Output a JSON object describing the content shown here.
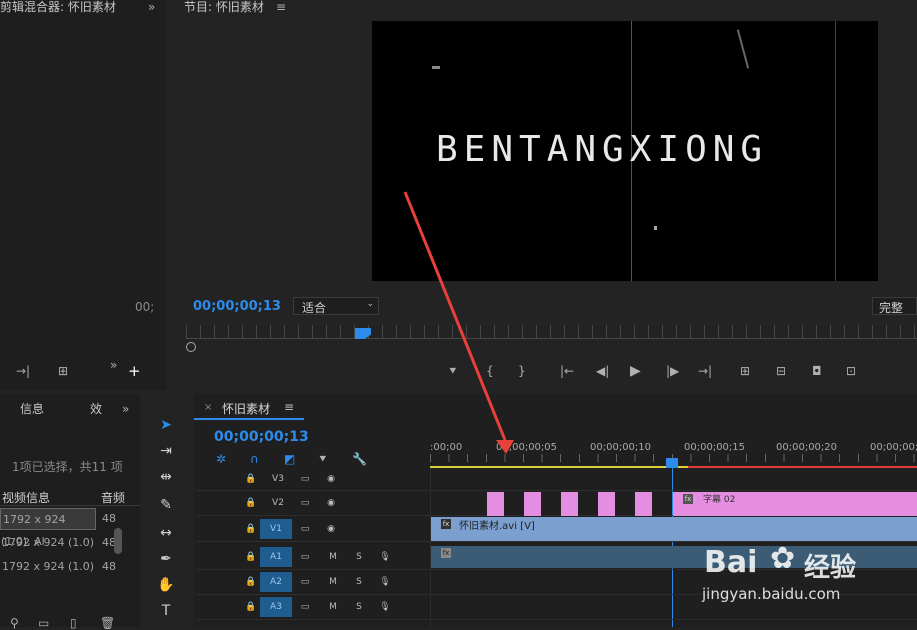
{
  "mixer": {
    "title": "剪辑混合器: 怀旧素材",
    "timecode": "00;"
  },
  "program": {
    "title": "节目: 怀旧素材",
    "video_text": "BENTANGXIONG",
    "timecode": "00;00;00;13",
    "fit": "适合",
    "quality": "完整"
  },
  "info": {
    "tab_info": "信息",
    "tab_effects": "效",
    "selection": "1项已选择，共11 项",
    "col_video": "视频信息",
    "col_audio": "音频",
    "rows": [
      {
        "video": "1792 x 924 (1.0), Al",
        "audio": "48"
      },
      {
        "video": "1792 x 924 (1.0)",
        "audio": "48"
      },
      {
        "video": "1792 x 924 (1.0)",
        "audio": "48"
      }
    ]
  },
  "timeline": {
    "title": "怀旧素材",
    "timecode": "00;00;00;13",
    "ticks": [
      ":00;00",
      "00;00;00;05",
      "00;00;00;10",
      "00;00;00;15",
      "00;00;00;20",
      "00;00;00;"
    ],
    "tracks": {
      "v3": "V3",
      "v2": "V2",
      "v1": "V1",
      "a1": "A1",
      "a2": "A2",
      "a3": "A3"
    },
    "clip_title": "字幕 02",
    "clip_video": "怀旧素材.avi [V]",
    "m": "M",
    "s": "S"
  },
  "watermark": {
    "brand": "Bai",
    "brand2": "经验",
    "url": "jingyan.baidu.com"
  }
}
